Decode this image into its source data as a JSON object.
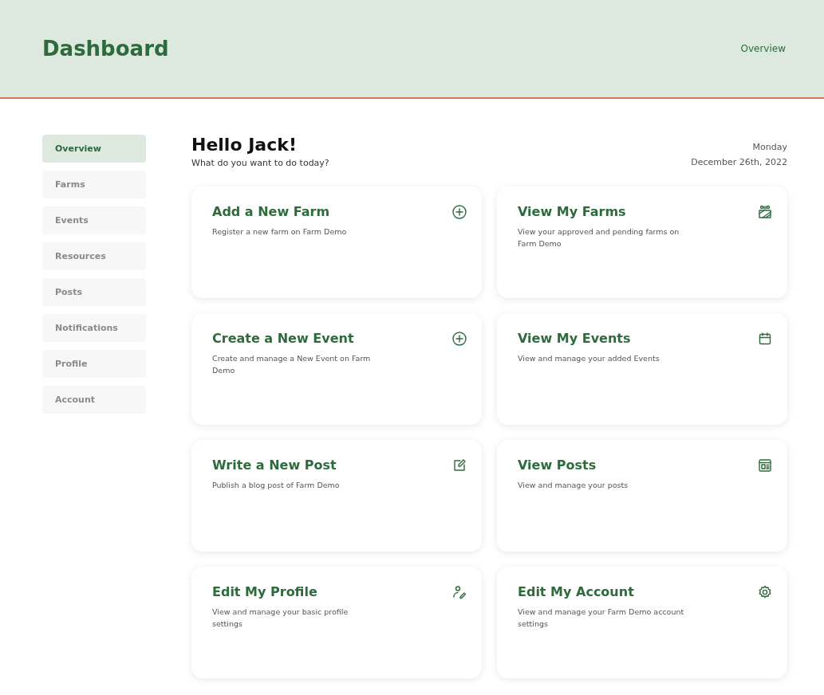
{
  "header": {
    "title": "Dashboard",
    "link": "Overview"
  },
  "sidebar": {
    "items": [
      {
        "label": "Overview",
        "selected": true
      },
      {
        "label": "Farms",
        "selected": false
      },
      {
        "label": "Events",
        "selected": false
      },
      {
        "label": "Resources",
        "selected": false
      },
      {
        "label": "Posts",
        "selected": false
      },
      {
        "label": "Notifications",
        "selected": false
      },
      {
        "label": "Profile",
        "selected": false
      },
      {
        "label": "Account",
        "selected": false
      }
    ]
  },
  "greeting": {
    "title": "Hello Jack!",
    "subtitle": "What do you want to do today?",
    "weekday": "Monday",
    "date": "December 26th, 2022"
  },
  "cards": [
    {
      "title": "Add a New Farm",
      "description": "Register a new farm on Farm Demo",
      "kind": "add"
    },
    {
      "title": "View My Farms",
      "description": "View your approved and pending farms on Farm Demo",
      "kind": "farm"
    },
    {
      "title": "Create a New Event",
      "description": "Create and manage a New Event on Farm Demo",
      "kind": "add"
    },
    {
      "title": "View My Events",
      "description": "View and manage your added Events",
      "kind": "calendar"
    },
    {
      "title": "Write a New Post",
      "description": "Publish a blog post of Farm Demo",
      "kind": "edit"
    },
    {
      "title": "View Posts",
      "description": "View and manage your posts",
      "kind": "posts"
    },
    {
      "title": "Edit My Profile",
      "description": "View and manage your basic profile settings",
      "kind": "profile"
    },
    {
      "title": "Edit My Account",
      "description": "View and manage your Farm Demo account settings",
      "kind": "settings"
    }
  ]
}
